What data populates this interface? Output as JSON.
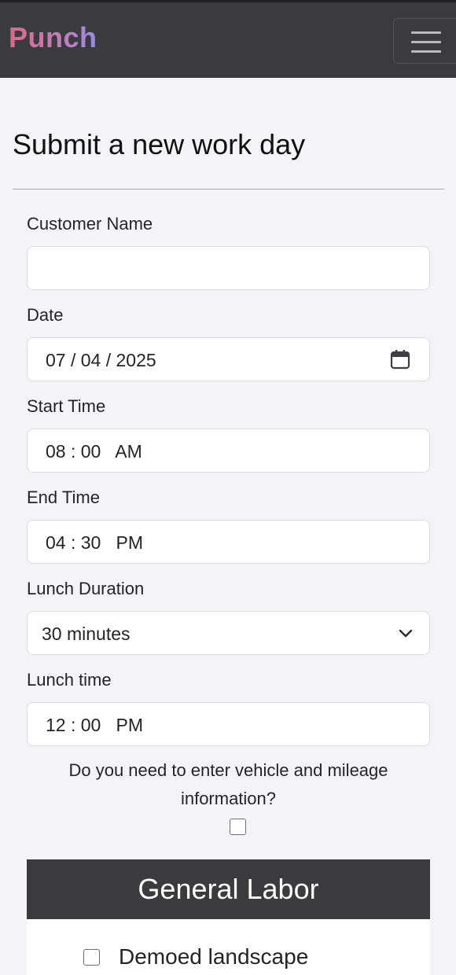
{
  "navbar": {
    "brand": "Punch",
    "toggle_icon": "hamburger-menu-icon"
  },
  "page": {
    "title": "Submit a new work day"
  },
  "form": {
    "customer_name": {
      "label": "Customer Name",
      "value": ""
    },
    "date": {
      "label": "Date",
      "value": "07 / 04 / 2025",
      "icon": "calendar-icon"
    },
    "start_time": {
      "label": "Start Time",
      "value": "08 : 00   AM"
    },
    "end_time": {
      "label": "End Time",
      "value": "04 : 30   PM"
    },
    "lunch_duration": {
      "label": "Lunch Duration",
      "value": "30 minutes",
      "icon": "chevron-down-icon"
    },
    "lunch_time": {
      "label": "Lunch time",
      "value": "12 : 00   PM"
    },
    "vehicle": {
      "question": "Do you need to enter vehicle and mileage information?",
      "checked": false
    }
  },
  "general_labor": {
    "title": "General Labor",
    "items": [
      {
        "label": "Demoed landscape",
        "checked": false
      }
    ]
  },
  "colors": {
    "navbar_bg": "#3a3b3f",
    "page_bg": "#f3f4f8",
    "brand_gradient_start": "#d76a86",
    "brand_gradient_end": "#9b8be0"
  }
}
